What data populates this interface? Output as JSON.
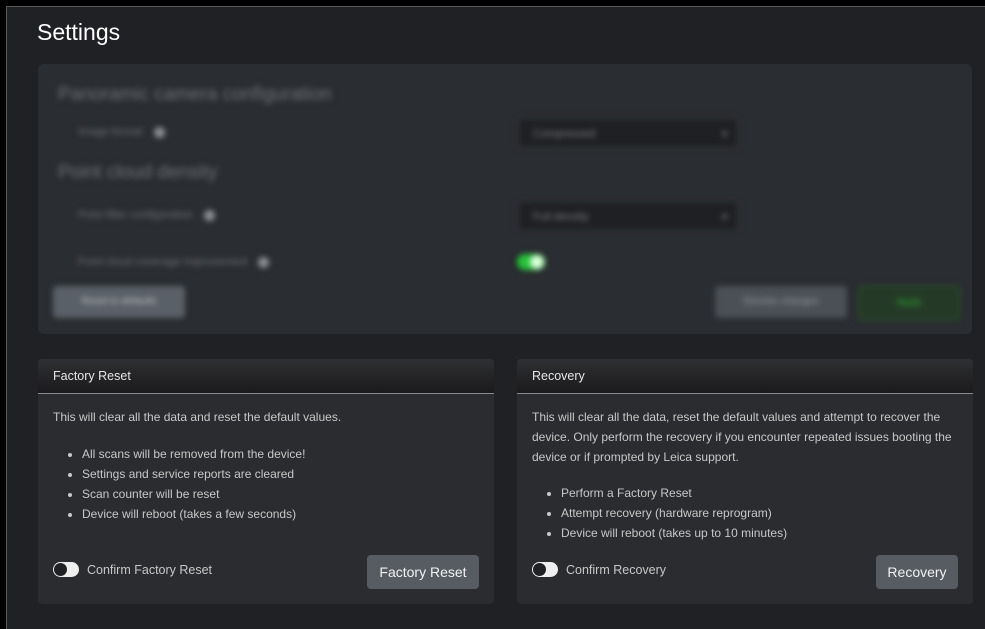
{
  "page": {
    "title": "Settings"
  },
  "camera_config": {
    "title": "Panoramic camera configuration",
    "image_format_label": "Image format",
    "image_format_value": "Compressed",
    "density_title": "Point cloud density",
    "filter_label": "Point filter configuration",
    "filter_value": "Full density",
    "coverage_label": "Point cloud coverage improvement",
    "coverage_enabled": true,
    "reset_label": "Reset to defaults",
    "dismiss_label": "Dismiss changes",
    "apply_label": "Apply"
  },
  "factory_reset": {
    "header": "Factory Reset",
    "description": "This will clear all the data and reset the default values.",
    "items": [
      "All scans will be removed from the device!",
      "Settings and service reports are cleared",
      "Scan counter will be reset",
      "Device will reboot (takes a few seconds)"
    ],
    "confirm_label": "Confirm Factory Reset",
    "button_label": "Factory Reset"
  },
  "recovery": {
    "header": "Recovery",
    "description": "This will clear all the data, reset the default values and attempt to recover the device. Only perform the recovery if you encounter repeated issues booting the device or if prompted by Leica support.",
    "items": [
      "Perform a Factory Reset",
      "Attempt recovery (hardware reprogram)",
      "Device will reboot (takes up to 10 minutes)"
    ],
    "confirm_label": "Confirm Recovery",
    "button_label": "Recovery"
  },
  "colors": {
    "background": "#202124",
    "card": "#2a2c30",
    "accent_green": "#27c23a",
    "button": "#575c63"
  }
}
